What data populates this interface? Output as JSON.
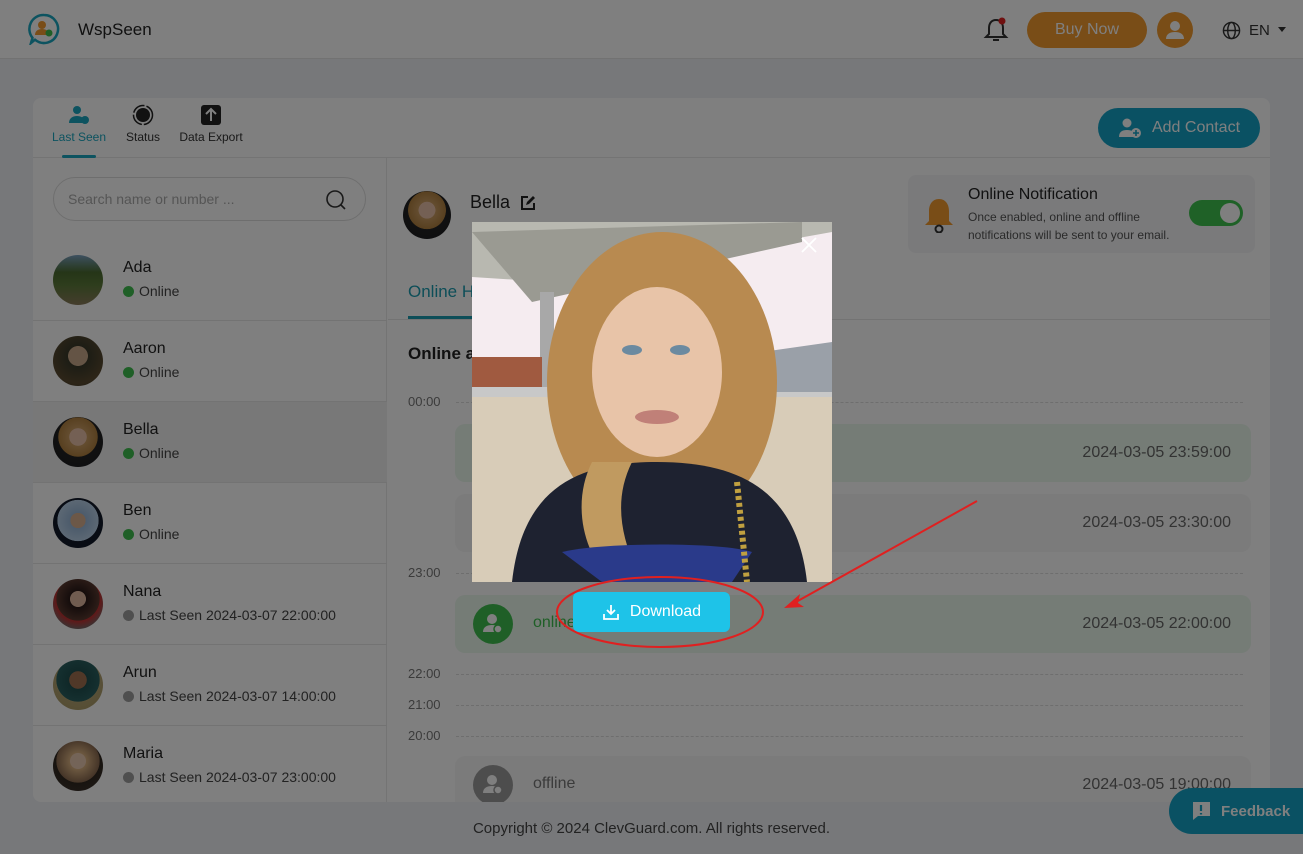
{
  "app": {
    "brand": "WspSeen",
    "buy_now": "Buy Now",
    "language": "EN"
  },
  "nav_tabs": [
    {
      "label": "Last Seen",
      "active": true
    },
    {
      "label": "Status",
      "active": false
    },
    {
      "label": "Data Export",
      "active": false
    }
  ],
  "add_contact": "Add Contact",
  "search": {
    "placeholder": "Search name or number ...",
    "value": ""
  },
  "contacts": [
    {
      "name": "Ada",
      "status": "Online",
      "online": true
    },
    {
      "name": "Aaron",
      "status": "Online",
      "online": true
    },
    {
      "name": "Bella",
      "status": "Online",
      "online": true,
      "selected": true
    },
    {
      "name": "Ben",
      "status": "Online",
      "online": true
    },
    {
      "name": "Nana",
      "status": "Last Seen 2024-03-07 22:00:00",
      "online": false
    },
    {
      "name": "Arun",
      "status": "Last Seen 2024-03-07 14:00:00",
      "online": false
    },
    {
      "name": "Maria",
      "status": "Last Seen 2024-03-07 23:00:00",
      "online": false
    }
  ],
  "profile": {
    "name": "Bella"
  },
  "notification": {
    "title": "Online Notification",
    "description": "Once enabled, online and offline notifications will be sent to your email.",
    "enabled": true
  },
  "sub_tab": "Online H",
  "section_title": "Online a",
  "timeline": {
    "hours": [
      "00:00",
      "23:00",
      "22:00",
      "21:00",
      "20:00"
    ],
    "events": [
      {
        "label": "",
        "time": "2024-03-05 23:59:00",
        "kind": "online"
      },
      {
        "label": "",
        "time": "2024-03-05 23:30:00",
        "kind": "neutral"
      },
      {
        "label": "online",
        "time": "2024-03-05 22:00:00",
        "kind": "online"
      },
      {
        "label": "offline",
        "time": "2024-03-05 19:00:00",
        "kind": "offline"
      }
    ]
  },
  "footer": "Copyright © 2024 ClevGuard.com. All rights reserved.",
  "feedback": "Feedback",
  "modal": {
    "download": "Download"
  },
  "colors": {
    "accent": "#14a3c7",
    "buy": "#f29a2e",
    "online": "#3fbf4f",
    "download": "#1ec3e8",
    "annotation": "#e02020"
  }
}
